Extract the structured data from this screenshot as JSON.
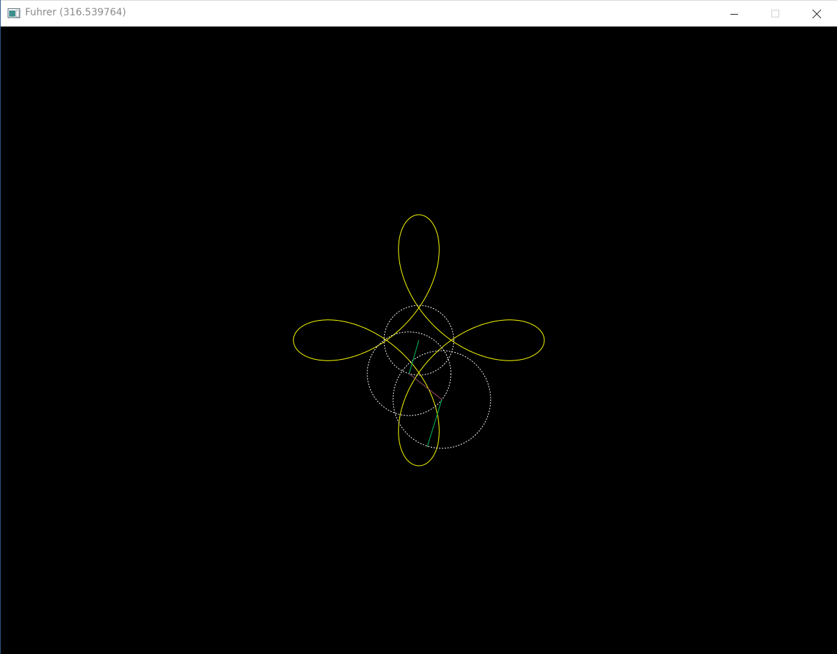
{
  "window": {
    "title": "Fuhrer (316.539764)",
    "background_color": "#000000",
    "titlebar_color": "#ffffff"
  },
  "controls": {
    "minimize_icon": "minimize-icon",
    "maximize_icon": "maximize-icon",
    "close_icon": "close-icon"
  },
  "scene": {
    "curve_color": "#ffff00",
    "circle_color": "#ffffff",
    "arm_color": "#00c060",
    "link_color": "#a05070",
    "curve_type": "four-loop roulette (epicycloid-like star with loops)",
    "circle_style": "dashed"
  }
}
